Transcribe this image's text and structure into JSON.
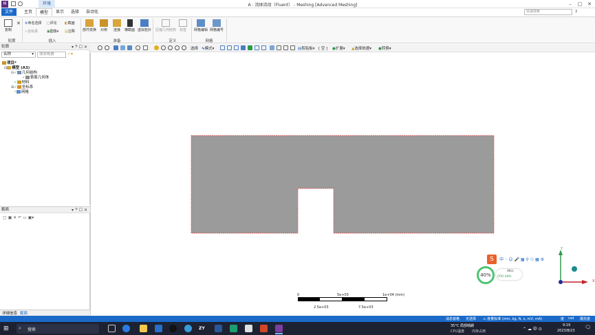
{
  "app": {
    "logo_letter": "M",
    "context_tab": "环境",
    "window_title": "A : 流体流动（Fluent） - Meshing [Advanced Meshing]",
    "help_search_placeholder": "快速搜索"
  },
  "ribbon_tabs": [
    "文件",
    "主页",
    "模型",
    "显示",
    "选择",
    "自动化"
  ],
  "ribbon": {
    "outline_group": {
      "label": "轮廓",
      "btn": "复制"
    },
    "insert_group": {
      "label": "插入",
      "items": [
        "命名选择",
        "评论",
        "截面",
        "坐标系",
        "图像",
        "注释"
      ]
    },
    "prepare_group": {
      "label": "准备",
      "items": [
        "部件变换",
        "对称",
        "连接",
        "横截面",
        "虚拟拓扑"
      ]
    },
    "define_group": {
      "label": "定义",
      "items": [
        "压缩几何结构",
        "标签"
      ]
    },
    "mesh_group": {
      "label": "网格",
      "items": [
        "网格编辑",
        "网格编号"
      ]
    }
  },
  "toolbar": {
    "select_label": "选择",
    "mode_label": "模式",
    "clipboard_label": "剪贴板",
    "empty_label": "[ 空 ]",
    "extend_label": "扩展",
    "select_by_label": "选择依据",
    "convert_label": "转换"
  },
  "outline": {
    "title": "轮廓",
    "name_filter": "名称",
    "search_placeholder": "搜索概要",
    "tree": [
      {
        "label": "项目*",
        "level": 0
      },
      {
        "label": "模型 (A3)",
        "level": 1
      },
      {
        "label": "几何结构",
        "level": 2
      },
      {
        "label": "表面几何体",
        "level": 3
      },
      {
        "label": "材料",
        "level": 2
      },
      {
        "label": "坐标系",
        "level": 2
      },
      {
        "label": "网格",
        "level": 2
      }
    ]
  },
  "section_panel": {
    "title": "截面"
  },
  "bottom_tabs": [
    "详细信息",
    "截面"
  ],
  "scale_bar": {
    "unit": "1e+04 (mm)",
    "top_labels": [
      "0",
      "5e+03",
      "1e+04 (mm)"
    ],
    "bottom_labels": [
      "2.5e+03",
      "7.5e+03"
    ]
  },
  "triad": {
    "x": "X",
    "y": "Y"
  },
  "widget": {
    "cpu_percent": "40%",
    "net_label": "0K/s",
    "cpu_label": "CPU 44%"
  },
  "status": {
    "messages": "消息窗格",
    "selection": "无选择",
    "units": "度量标准 (mm, kg, N, s, mV, mA)",
    "angle": "度",
    "rad": "rad",
    "temp": "摄氏度"
  },
  "taskbar": {
    "search": "搜索",
    "weather": "35°C 局部晴朗",
    "clock_time": "9:19",
    "clock_date": "2023/8/23",
    "tray_cpu": "CPU温度",
    "tray_mem": "内存占用"
  },
  "colors": {
    "accent": "#1b6ac9",
    "mesh_fill": "#9b9b9b",
    "outline_edge": "#e04545"
  }
}
